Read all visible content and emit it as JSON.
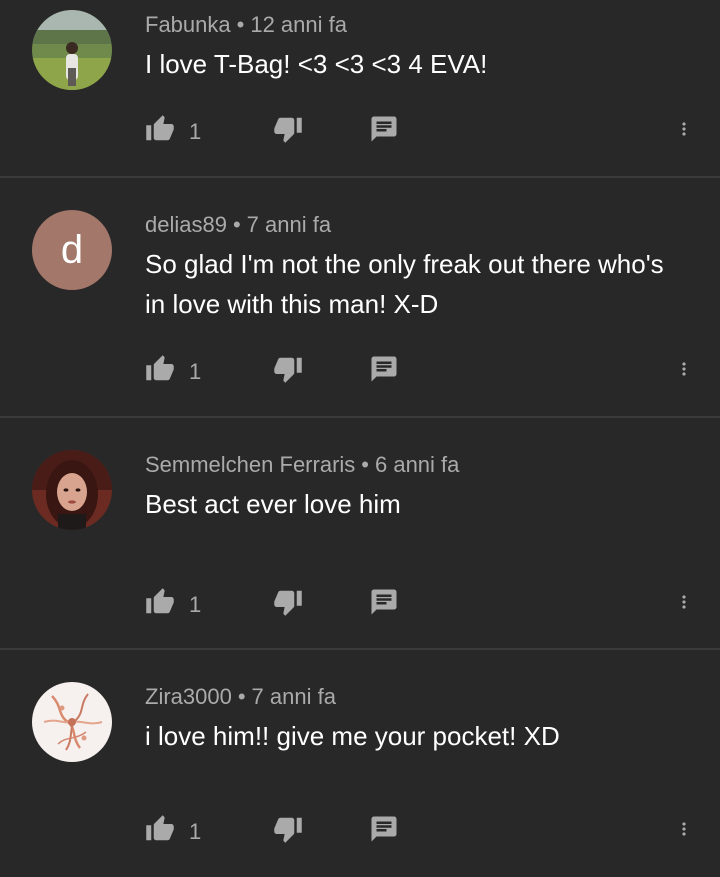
{
  "comments": [
    {
      "author": "Fabunka",
      "separator": "•",
      "time": "12 anni fa",
      "text": "I love T-Bag! <3 <3 <3 4 EVA!",
      "likes": "1",
      "avatar": "photo"
    },
    {
      "author": "delias89",
      "separator": "•",
      "time": "7 anni fa",
      "text": "So glad I'm not the only freak out there who's in love with this man! X-D",
      "likes": "1",
      "avatar_letter": "d",
      "avatar_color": "#a3776a"
    },
    {
      "author": "Semmelchen Ferraris",
      "separator": "•",
      "time": "6 anni fa",
      "text": "Best act ever love him",
      "likes": "1",
      "avatar": "photo"
    },
    {
      "author": "Zira3000",
      "separator": "•",
      "time": "7 anni fa",
      "text": "i love him!! give me your pocket! XD",
      "likes": "1",
      "avatar": "photo"
    }
  ],
  "icons": {
    "like": "thumb-up-icon",
    "dislike": "thumb-down-icon",
    "reply": "comment-icon",
    "more": "more-vert-icon"
  },
  "colors": {
    "background": "#282828",
    "secondary_text": "#aaaaaa",
    "divider": "#3a3a3a"
  }
}
